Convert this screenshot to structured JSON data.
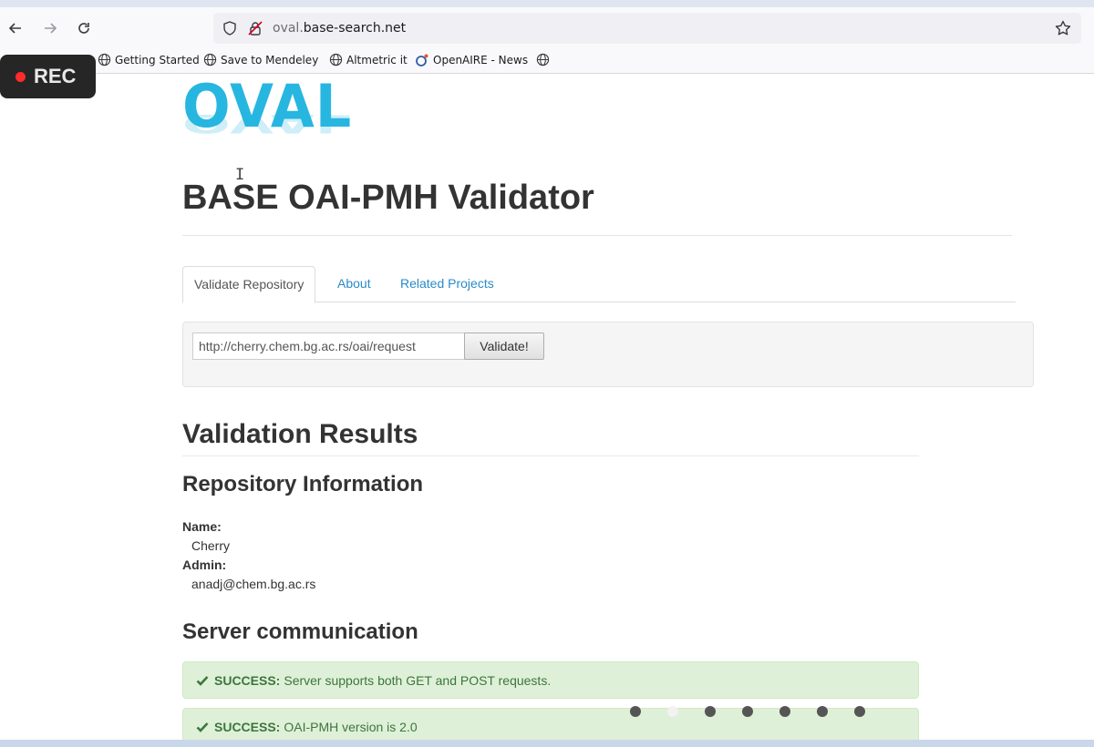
{
  "browser": {
    "url_host_prefix": "oval.",
    "url_host_main": "base-search.net",
    "bookmarks": [
      {
        "label": "Getting Started"
      },
      {
        "label": "Save to Mendeley"
      },
      {
        "label": "Altmetric it"
      },
      {
        "label": "OpenAIRE - News"
      }
    ]
  },
  "recording": {
    "label": "REC"
  },
  "site": {
    "logo_text": "OVAL",
    "title": "BASE OAI-PMH Validator",
    "tabs": [
      {
        "label": "Validate Repository"
      },
      {
        "label": "About"
      },
      {
        "label": "Related Projects"
      }
    ],
    "form": {
      "url_value": "http://cherry.chem.bg.ac.rs/oai/request",
      "button_label": "Validate!"
    }
  },
  "results": {
    "heading": "Validation Results",
    "repo_heading": "Repository Information",
    "name_label": "Name:",
    "name_value": "Cherry",
    "admin_label": "Admin:",
    "admin_value": "anadj@chem.bg.ac.rs",
    "server_heading": "Server communication",
    "alerts": [
      {
        "status": "SUCCESS:",
        "message": "Server supports both GET and POST requests."
      },
      {
        "status": "SUCCESS:",
        "message": "OAI-PMH version is 2.0"
      }
    ]
  },
  "carousel": {
    "count": 7,
    "active_index": 1
  },
  "colors": {
    "logo": "#27b6e0",
    "link": "#2a8ac7",
    "success_bg": "#dff0d8",
    "success_text": "#3c763d"
  }
}
